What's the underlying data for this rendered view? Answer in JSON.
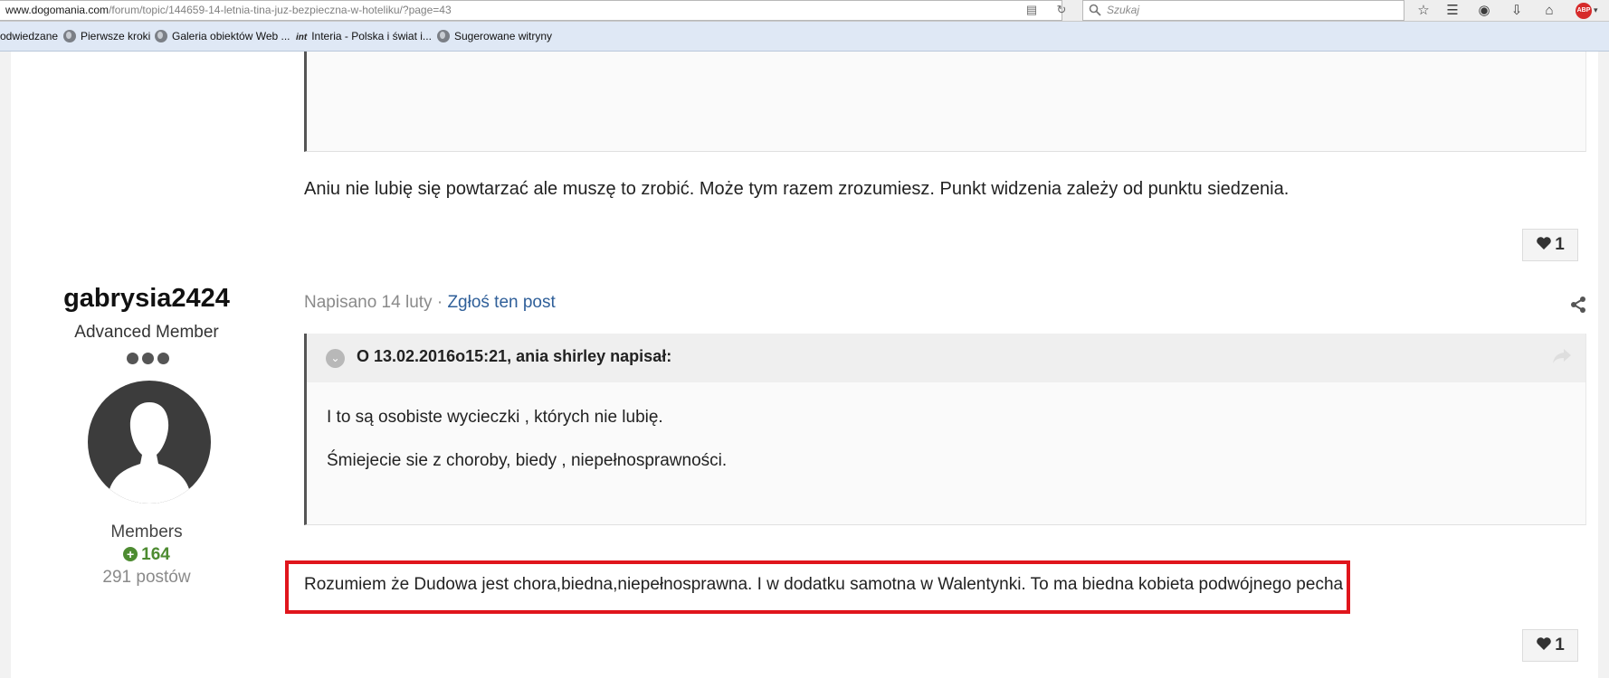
{
  "browser": {
    "url_host": "www.dogomania.com",
    "url_path": "/forum/topic/144659-14-letnia-tina-juz-bezpieczna-w-hoteliku/?page=43",
    "search_placeholder": "Szukaj",
    "abp_label": "ABP"
  },
  "bookmarks": [
    {
      "label": "odwiedzane"
    },
    {
      "label": "Pierwsze kroki"
    },
    {
      "label": "Galeria obiektów Web ..."
    },
    {
      "label": "Interia - Polska i świat i..."
    },
    {
      "label": "Sugerowane witryny"
    }
  ],
  "bookmark_int_logo": "int",
  "post_prev": {
    "text": "Aniu nie lubię się powtarzać ale muszę to zrobić. Może tym razem zrozumiesz. Punkt widzenia zależy od punktu siedzenia.",
    "likes": "1"
  },
  "post": {
    "author": {
      "username": "gabrysia2424",
      "rank": "Advanced Member",
      "group": "Members",
      "reputation": "164",
      "posts_count": "291 postów"
    },
    "meta_date": "Napisano 14 luty",
    "meta_sep": " · ",
    "report_label": "Zgłoś ten post",
    "quote": {
      "header": "O 13.02.2016o15:21, ania shirley napisał:",
      "lines": [
        "I to są osobiste wycieczki , których nie lubię.",
        "Śmiejecie sie z choroby, biedy , niepełnosprawności."
      ]
    },
    "text": "Rozumiem że Dudowa jest chora,biedna,niepełnosprawna. I w dodatku samotna w Walentynki. To ma biedna kobieta podwójnego pecha",
    "likes": "1"
  },
  "colors": {
    "highlight_border": "#e0151c",
    "link": "#2f5f99",
    "reputation": "#4d8b31"
  }
}
